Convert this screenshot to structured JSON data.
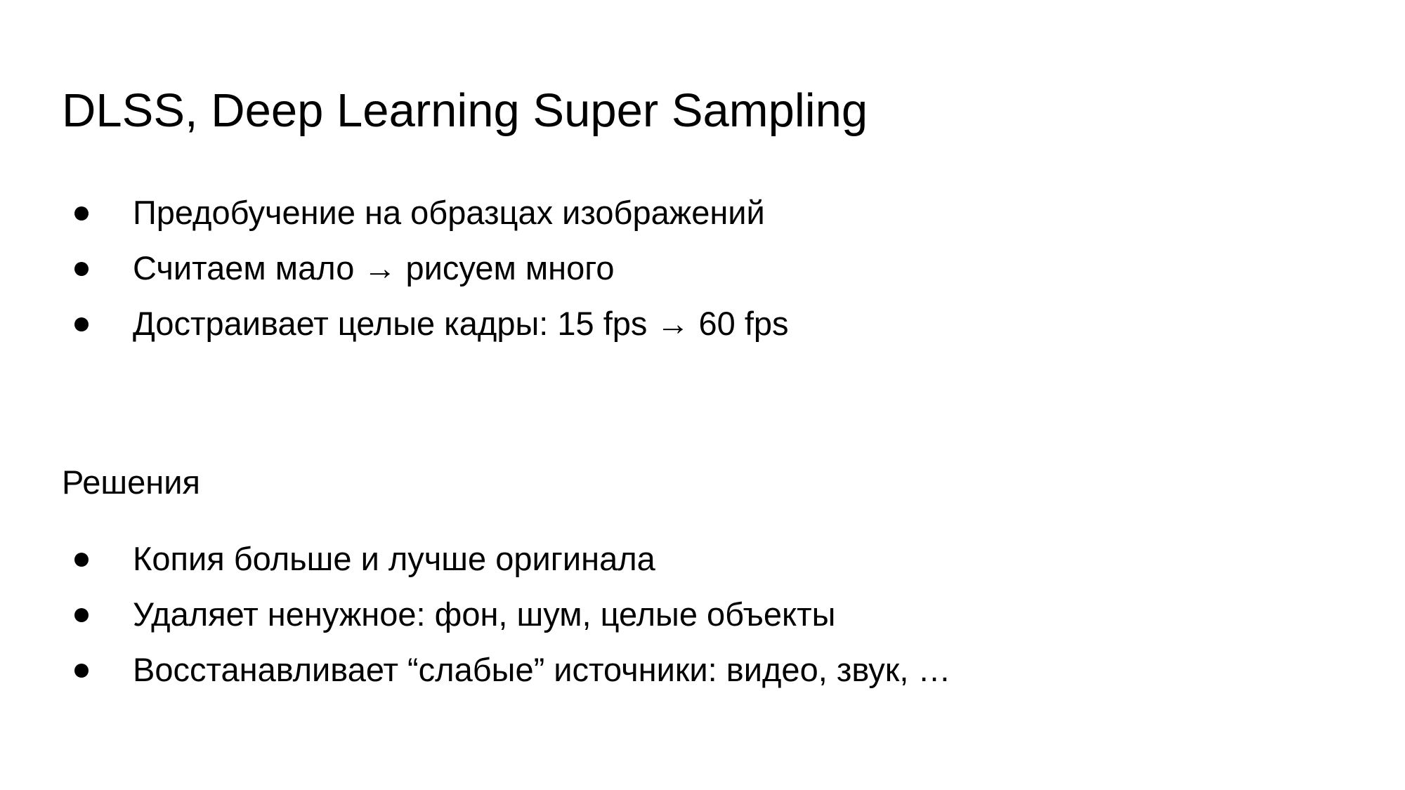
{
  "slide": {
    "title": "DLSS, Deep Learning Super Sampling",
    "section1": {
      "items": [
        "Предобучение на образцах изображений",
        "Считаем мало → рисуем много",
        "Достраивает целые кадры: 15 fps → 60 fps"
      ]
    },
    "section2": {
      "heading": "Решения",
      "items": [
        "Копия больше и лучше оригинала",
        "Удаляет ненужное: фон, шум, целые объекты",
        "Восстанавливает “слабые” источники: видео, звук, …"
      ]
    }
  }
}
